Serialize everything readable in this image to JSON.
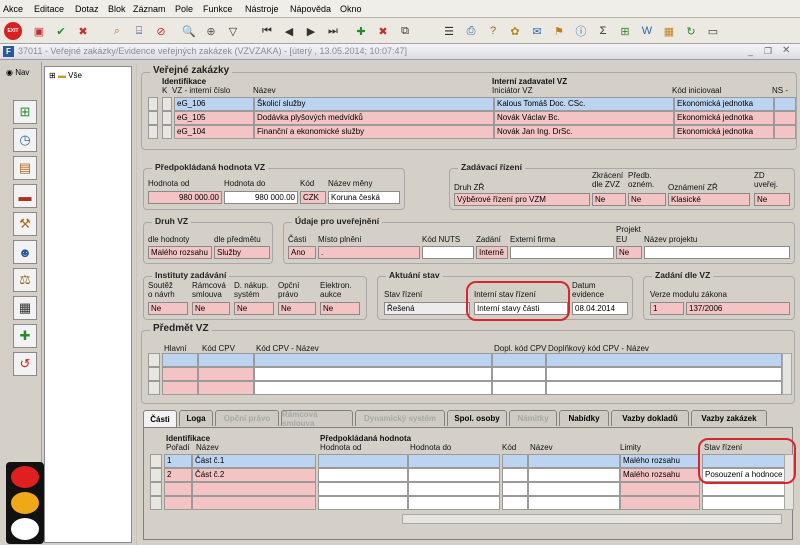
{
  "menu": [
    "Akce",
    "Editace",
    "Dotaz",
    "Blok",
    "Záznam",
    "Pole",
    "Funkce",
    "Nástroje",
    "Nápověda",
    "Okno"
  ],
  "toolbar": {
    "exit_label": "EXIT"
  },
  "window": {
    "title": "37011 - Veřejné zakázky/Evidence veřejných zakázek (VZVZAKA) - [úterý , 13.05.2014; 10:07:47]"
  },
  "nav": {
    "label": "Nav"
  },
  "tree": {
    "root": "Vše"
  },
  "vz": {
    "title": "Veřejné zakázky",
    "ident": "Identifikace",
    "k": "K",
    "vz_num": "VZ - interní číslo",
    "nazev": "Název",
    "internal_sponsor": "Interní zadavatel VZ",
    "initiator": "Iniciátor VZ",
    "code": "Kód iniciovaal",
    "ns": "NS -",
    "rows": [
      {
        "vz": "eG_106",
        "name": "Školicí služby",
        "init": "Kalous Tomáš Doc. CSc.",
        "code": "Ekonomická jednotka"
      },
      {
        "vz": "eG_105",
        "name": "Dodávka plyšových medvídků",
        "init": "Novák Václav Bc.",
        "code": "Ekonomická jednotka"
      },
      {
        "vz": "eG_104",
        "name": "Finanční a ekonomické služby",
        "init": "Novák Jan Ing. DrSc.",
        "code": "Ekonomická jednotka"
      }
    ]
  },
  "hodnota": {
    "title": "Předpokládaná hodnota VZ",
    "od_lbl": "Hodnota od",
    "do_lbl": "Hodnota do",
    "kod_lbl": "Kód",
    "mena_lbl": "Název měny",
    "od": "980 000.00",
    "do": "980 000.00",
    "kod": "CZK",
    "mena": "Koruna česká"
  },
  "zadavaci": {
    "title": "Zadávací řízení",
    "druh_lbl": "Druh ZŘ",
    "zkr_lbl1": "Zkrácení",
    "zkr_lbl2": "dle ZVZ",
    "pred_lbl1": "Předb.",
    "pred_lbl2": "ozném.",
    "ozn_lbl": "Oznámení ZŘ",
    "zd_lbl1": "ZD",
    "zd_lbl2": "uveřej.",
    "druh": "Výběrové řízení pro VZM",
    "zkr": "Ne",
    "pred": "Ne",
    "ozn": "Klasické",
    "zd": "Ne"
  },
  "druhvz": {
    "title": "Druh VZ",
    "hod_lbl": "dle hodnoty",
    "pred_lbl": "dle předmětu",
    "hod": "Malého rozsahu",
    "pred": "Služby"
  },
  "udaje": {
    "title": "Údaje pro uveřejnění",
    "casti_lbl": "Části",
    "misto_lbl": "Místo plnění",
    "nuts_lbl": "Kód NUTS",
    "zadani_lbl": "Zadání",
    "firma_lbl": "Externí firma",
    "proj_lbl1": "Projekt",
    "proj_lbl2": "EU",
    "naz_proj_lbl": "Název projektu",
    "casti": "Ano",
    "misto": ".",
    "zadani": "Interně",
    "proj": "Ne"
  },
  "instituty": {
    "title": "Instituty zadávání",
    "l1a": "Soutěž",
    "l1b": "o návrh",
    "l2a": "Rámcová",
    "l2b": "smlouva",
    "l3a": "D. nákup.",
    "l3b": "systém",
    "l4a": "Opční",
    "l4b": "právo",
    "l5a": "Elektron.",
    "l5b": "aukce",
    "v": "Ne"
  },
  "aktualni": {
    "title": "Aktuání stav",
    "stav_lbl": "Stav řízení",
    "int_lbl": "Interní stav řízení",
    "dat_lbl1": "Datum",
    "dat_lbl2": "evidence",
    "stav": "Řešená",
    "int": "Interní stavy části",
    "datum": "08.04.2014"
  },
  "zadani": {
    "title": "Zadání dle VZ",
    "verze_lbl": "Verze modulu zákona",
    "v1": "1",
    "v2": "137/2006"
  },
  "predmet": {
    "title": "Předmět VZ",
    "hlavni": "Hlavní",
    "kod": "Kód CPV",
    "kodnaz": "Kód CPV - Název",
    "dopl": "Dopl. kód CPV",
    "doplnaz": "Doplňkový kód CPV - Název"
  },
  "tabs": [
    "Části",
    "Loga",
    "Opční právo",
    "Rámcová smlouva",
    "Dynamický systém",
    "Spol. osoby",
    "Námitky",
    "Nabídky",
    "Vazby dokladů",
    "Vazby zakázek"
  ],
  "casti": {
    "ident": "Identifikace",
    "poradi": "Pořadí",
    "nazev": "Název",
    "hodnota": "Předpokládaná hodnota",
    "od": "Hodnota od",
    "do": "Hodnota do",
    "kod": "Kód",
    "naz": "Název",
    "limity": "Limity",
    "stav": "Stav řízení",
    "rows": [
      {
        "p": "1",
        "n": "Část č.1",
        "lim": "Malého rozsahu",
        "stav": ""
      },
      {
        "p": "2",
        "n": "Část č.2",
        "lim": "Malého rozsahu",
        "stav": "Posouzení a hodnoce"
      }
    ]
  }
}
